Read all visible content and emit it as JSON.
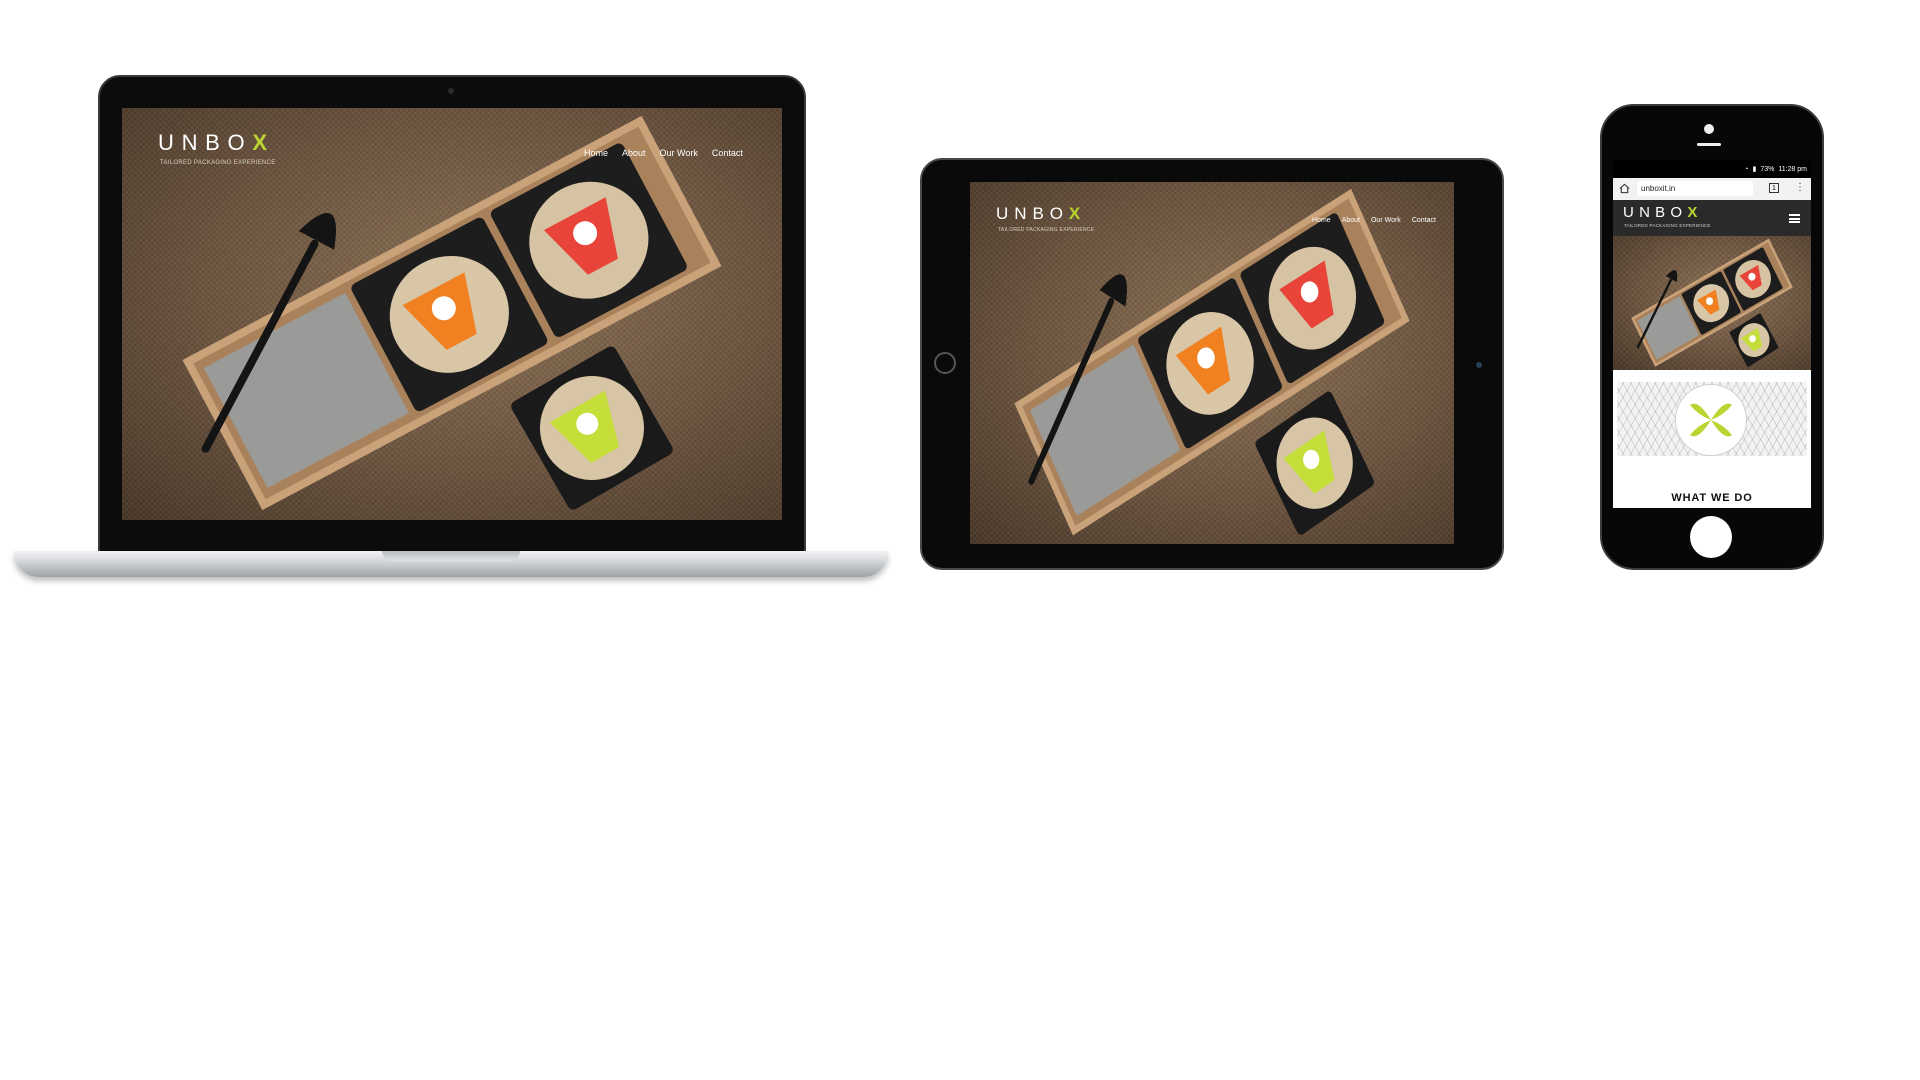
{
  "site": {
    "brand_text": "UNBO",
    "brand_x": "X",
    "tagline": "TAILORED  PACKAGING  EXPERIENCE",
    "nav": [
      "Home",
      "About",
      "Our Work",
      "Contact"
    ]
  },
  "phone": {
    "status_time": "11:28 pm",
    "battery": "73%",
    "url": "unboxit.in",
    "partial_heading": "WHAT WE DO"
  },
  "colors": {
    "accent_green": "#b9d532",
    "label_orange": "#f08020",
    "label_red": "#e8443a",
    "label_lime": "#c5de3a"
  },
  "icons": {
    "home": "home-icon",
    "tabs": "tabs-icon",
    "menu": "more-vert-icon",
    "hamburger": "hamburger-menu-icon"
  }
}
